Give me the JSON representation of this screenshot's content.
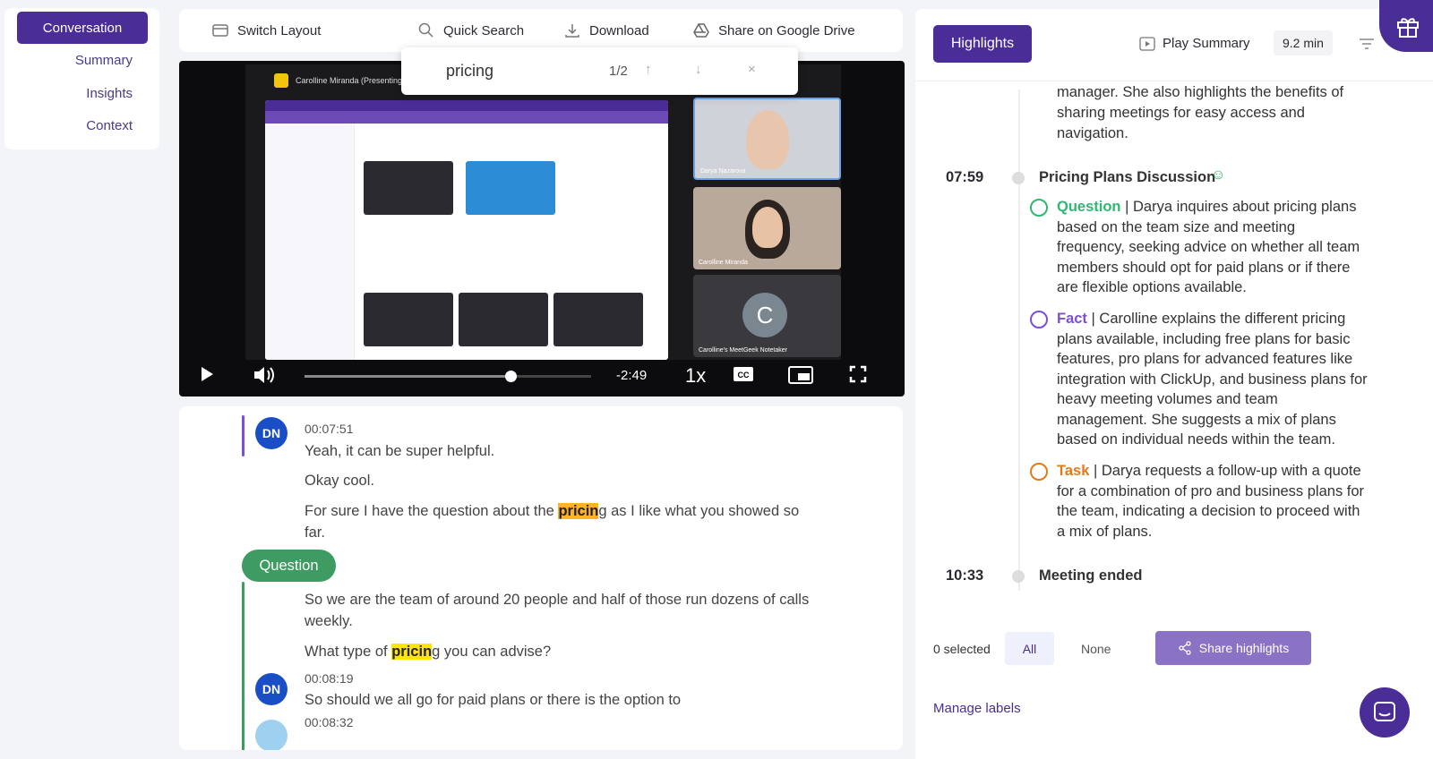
{
  "nav": {
    "items": [
      {
        "label": "Conversation",
        "active": true
      },
      {
        "label": "Summary"
      },
      {
        "label": "Insights"
      },
      {
        "label": "Context"
      }
    ]
  },
  "toolbar": {
    "switch_layout": "Switch Layout",
    "quick_search": "Quick Search",
    "download": "Download",
    "share_drive": "Share on Google Drive"
  },
  "search": {
    "query": "pricing",
    "count": "1/2"
  },
  "video": {
    "presenter": "Carolline Miranda (Presenting)",
    "tiles": [
      "Darya Nazarova",
      "Carolline Miranda",
      "Carolline's MeetGeek Notetaker"
    ],
    "notetaker_initial": "C",
    "remaining": "-2:49",
    "speed": "1x",
    "progress": 0.74
  },
  "transcript": {
    "entries": [
      {
        "speaker_initials": "DN",
        "time": "00:07:51",
        "line1": "Yeah, it can be super helpful.",
        "line2": "Okay cool.",
        "line3a": "For sure I have the question about the ",
        "line3hl": "pricin",
        "line3b": "g as I like what you showed so",
        "line3c": "far."
      },
      {
        "badge": "Question",
        "line1": "So we are the team of around 20 people and half of those run dozens of calls",
        "line1b": "weekly.",
        "line2a": "What type of ",
        "line2hl": "pricin",
        "line2b": "g you can advise?"
      },
      {
        "speaker_initials": "DN",
        "time": "00:08:19",
        "line1": "So should we all go for paid plans or there is the option to"
      },
      {
        "time": "00:08:32"
      }
    ]
  },
  "right": {
    "highlights_label": "Highlights",
    "play_summary": "Play Summary",
    "duration": "9.2 min",
    "top_text": [
      "manager. She also highlights the benefits of",
      "sharing meetings for easy access and",
      "navigation."
    ],
    "sections": [
      {
        "time": "07:59",
        "title": "Pricing Plans Discussion",
        "items": [
          {
            "type": "Question",
            "color": "#2eb872",
            "lines": [
              "| Darya inquires about pricing plans",
              "based on the team size and meeting",
              "frequency, seeking advice on whether all team",
              "members should opt for paid plans or if there",
              "are flexible options available."
            ]
          },
          {
            "type": "Fact",
            "color": "#7b4fd6",
            "lines": [
              "| Carolline explains the different pricing",
              "plans available, including free plans for basic",
              "features, pro plans for advanced features like",
              "integration with ClickUp, and business plans for",
              "heavy meeting volumes and team",
              "management. She suggests a mix of plans",
              "based on individual needs within the team."
            ]
          },
          {
            "type": "Task",
            "color": "#e07b1a",
            "lines": [
              "| Darya requests a follow-up with a quote",
              "for a combination of pro and business plans for",
              "the team, indicating a decision to proceed with",
              "a mix of plans."
            ]
          }
        ]
      },
      {
        "time": "10:33",
        "title": "Meeting ended"
      }
    ],
    "selected": "0 selected",
    "all": "All",
    "none": "None",
    "share": "Share highlights",
    "manage": "Manage labels"
  }
}
